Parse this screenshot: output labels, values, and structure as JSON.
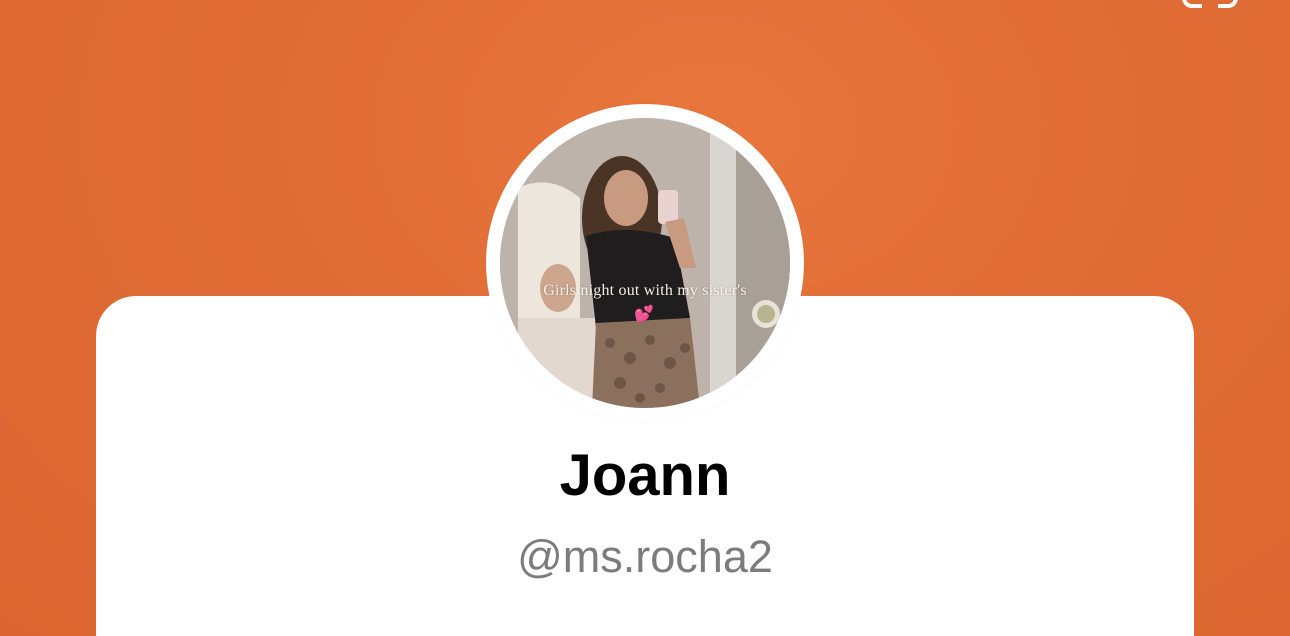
{
  "profile": {
    "display_name": "Joann",
    "handle": "@ms.rocha2",
    "avatar": {
      "caption": "Girls night out with my sister's",
      "emoji": "💕"
    }
  },
  "colors": {
    "background": "#e06c35",
    "card": "#ffffff",
    "name_text": "#000000",
    "handle_text": "#7c7c7c"
  }
}
